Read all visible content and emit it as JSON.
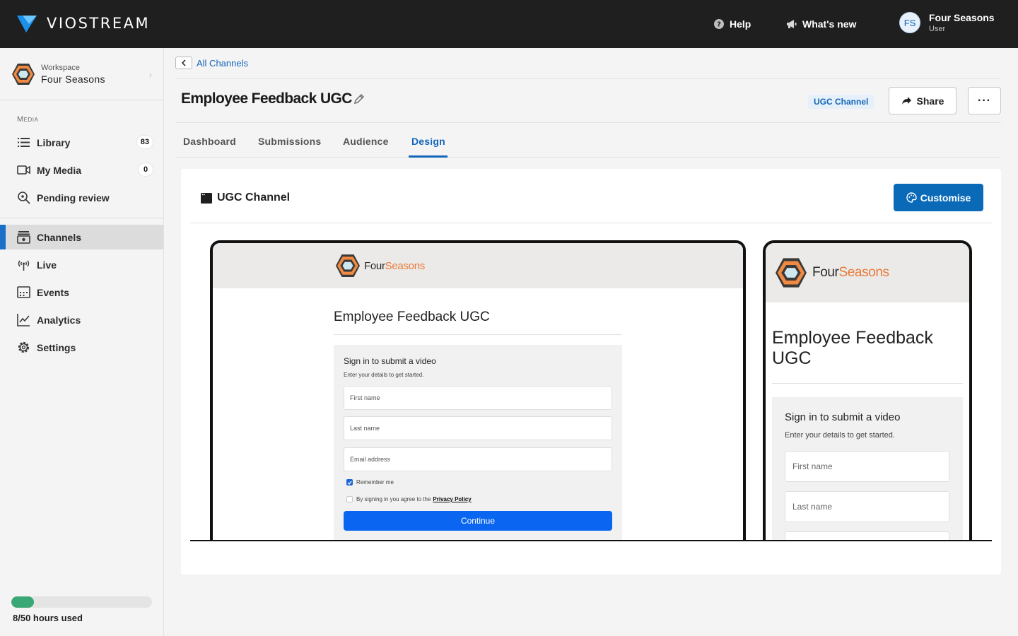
{
  "brand": {
    "name": "VIOSTREAM",
    "accent": "#1c6fc8"
  },
  "topbar": {
    "help_label": "Help",
    "whats_new_label": "What's new",
    "user": {
      "initials": "FS",
      "name": "Four Seasons",
      "role": "User"
    }
  },
  "sidebar": {
    "workspace_label": "Workspace",
    "workspace_name": "Four Seasons",
    "section_media": "Media",
    "items": [
      {
        "label": "Library",
        "count": "83",
        "icon": "list-icon"
      },
      {
        "label": "My Media",
        "count": "0",
        "icon": "video-camera-icon"
      },
      {
        "label": "Pending review",
        "icon": "magnify-icon"
      },
      {
        "label": "Channels",
        "icon": "channels-icon",
        "active": true
      },
      {
        "label": "Live",
        "icon": "broadcast-icon"
      },
      {
        "label": "Events",
        "icon": "calendar-icon"
      },
      {
        "label": "Analytics",
        "icon": "chart-icon"
      },
      {
        "label": "Settings",
        "icon": "gear-icon"
      }
    ],
    "usage": {
      "text": "8/50 hours used",
      "used": 8,
      "total": 50,
      "color": "#3aa876"
    }
  },
  "breadcrumb": {
    "back_label": "All Channels"
  },
  "page": {
    "title": "Employee Feedback UGC",
    "badge": "UGC Channel",
    "share_label": "Share",
    "more_label": "···"
  },
  "tabs": [
    {
      "label": "Dashboard"
    },
    {
      "label": "Submissions"
    },
    {
      "label": "Audience"
    },
    {
      "label": "Design",
      "active": true
    }
  ],
  "card": {
    "title": "UGC Channel",
    "customise_label": "Customise"
  },
  "preview": {
    "logo_four": "Four",
    "logo_seasons": "Seasons",
    "title": "Employee Feedback UGC",
    "form_title": "Sign in to submit a video",
    "form_subtitle": "Enter your details to get started.",
    "first_name": "First name",
    "last_name": "Last name",
    "email": "Email address",
    "remember": "Remember me",
    "agree_prefix": "By signing in you agree to the",
    "privacy": "Privacy Policy",
    "continue": "Continue"
  }
}
